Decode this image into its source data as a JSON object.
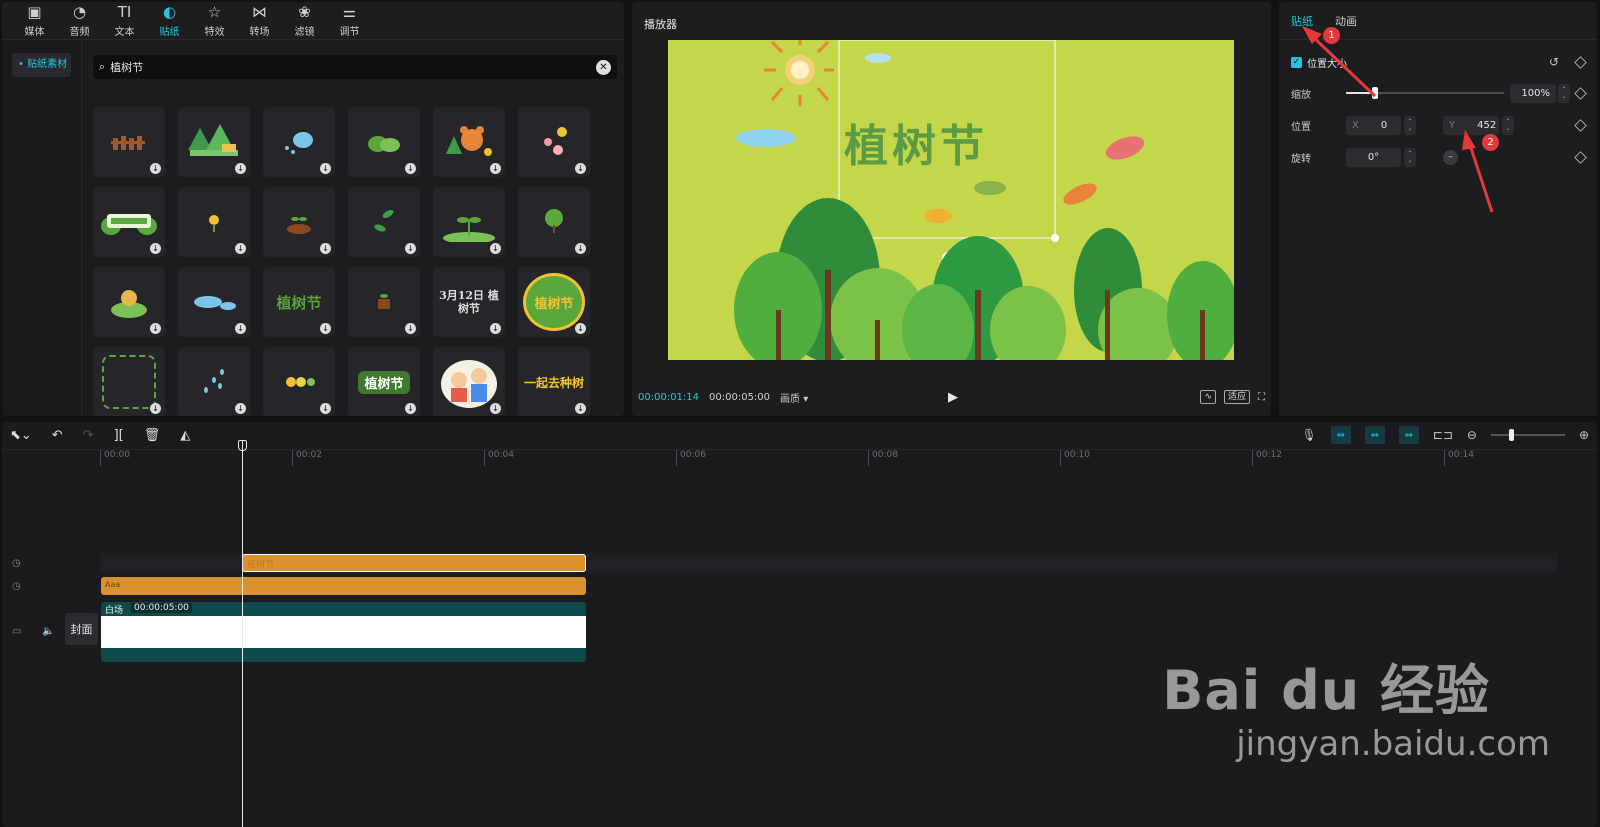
{
  "toolbar": {
    "tools": [
      {
        "icon": "media-icon",
        "glyph": "▣",
        "label": "媒体"
      },
      {
        "icon": "audio-icon",
        "glyph": "◔",
        "label": "音频"
      },
      {
        "icon": "text-icon",
        "glyph": "TI",
        "label": "文本"
      },
      {
        "icon": "sticker-icon",
        "glyph": "◐",
        "label": "贴纸",
        "active": true
      },
      {
        "icon": "effects-icon",
        "glyph": "☆",
        "label": "特效"
      },
      {
        "icon": "transition-icon",
        "glyph": "⋈",
        "label": "转场"
      },
      {
        "icon": "filter-icon",
        "glyph": "❀",
        "label": "滤镜"
      },
      {
        "icon": "adjust-icon",
        "glyph": "⚌",
        "label": "调节"
      }
    ]
  },
  "sidebar": {
    "item": "• 贴纸素材"
  },
  "search": {
    "value": "植树节",
    "clear": "✕"
  },
  "stickers": {
    "text_1": "植树节",
    "text_2": "3月12日 植树节",
    "text_3": "植树节",
    "text_4": "植树节",
    "text_5": "一起去种树"
  },
  "player": {
    "title": "播放器",
    "current_time": "00:00:01:14",
    "total_time": "00:00:05:00",
    "ratio": "画质 ▾",
    "play": "▶",
    "fit": "适应",
    "canvas_text": "植树节"
  },
  "props": {
    "tabs": [
      "贴纸",
      "动画"
    ],
    "section": "位置大小",
    "scale_label": "缩放",
    "scale_value": "100%",
    "scale_fraction": 0.17,
    "position_label": "位置",
    "x_label": "X",
    "x_value": "0",
    "y_label": "Y",
    "y_value": "452",
    "rotate_label": "旋转",
    "rotate_value": "0°",
    "reset": "↺"
  },
  "timeline": {
    "ticks": [
      "00:00",
      "00:02",
      "00:04",
      "00:06",
      "00:08",
      "00:10",
      "00:12",
      "00:14"
    ],
    "sticker_clip_label": "植树节",
    "text_clip_label": "Aaa",
    "main_clip_name": "白场",
    "main_clip_duration": "00:00:05:00",
    "cover": "封面"
  },
  "annotations": {
    "badge_1": "1",
    "badge_2": "2"
  },
  "watermark": {
    "logo": "Bai du 经验",
    "url": "jingyan.baidu.com"
  },
  "colors": {
    "accent": "#1fc8e0",
    "clip_orange": "#d9922f",
    "canvas_bg": "#c4d64a",
    "annotation": "#e23a3a"
  }
}
